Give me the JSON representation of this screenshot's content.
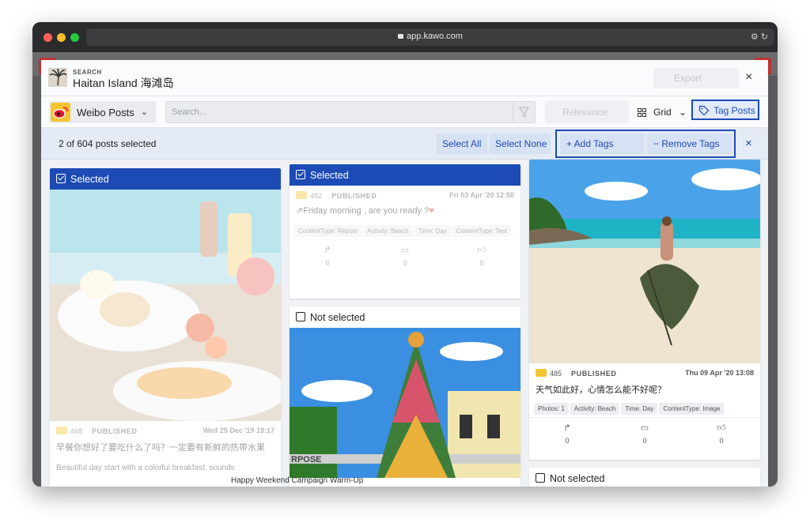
{
  "browser": {
    "url": "app.kawo.com",
    "icons": "⚙︎ ↻"
  },
  "colors": {
    "accent": "#1d4bb5",
    "selected_header": "#1d4bb5",
    "weibo": "#f3c431"
  },
  "header": {
    "kicker": "SEARCH",
    "title": "Haitan Island 海滩岛",
    "export_label": "Export",
    "close_icon": "×"
  },
  "toolbar": {
    "platform": "Weibo Posts",
    "search_placeholder": "Search...",
    "sort_label": "Relevance",
    "view_label": "Grid",
    "tag_posts_label": "Tag Posts"
  },
  "selection_bar": {
    "count_text": "2 of 604 posts selected",
    "select_all": "Select All",
    "select_none": "Select None",
    "add_tags": "+  Add Tags",
    "remove_tags": "−  Remove Tags",
    "close_icon": "×"
  },
  "posts": [
    {
      "header": "Selected",
      "selected": true,
      "count": "468",
      "status": "PUBLISHED",
      "date": "Wed 25 Dec '19 19:17",
      "text": "早餐你想好了要吃什么了吗？一定要有新鲜的热带水果",
      "caption": "Beautiful day start with a colorful breakfast, sounds"
    },
    {
      "header": "Selected",
      "selected": true,
      "count": "482",
      "status": "PUBLISHED",
      "date": "Fri 03 Apr '20 12:50",
      "text": "Friday morning , are you ready ?",
      "tags": [
        "ContentType: Repost",
        "Activity: Beach",
        "Time: Day",
        "ContentType: Test"
      ],
      "stats": [
        "0",
        "0",
        "0"
      ]
    },
    {
      "header": "Not selected",
      "selected": false,
      "bottom_caption": "Happy Weekend Campaign Warm-Up",
      "sign_text": "RPOSE"
    },
    {
      "count": "485",
      "status": "PUBLISHED",
      "date": "Thu 09 Apr '20 13:08",
      "text": "天气如此好，心情怎么能不好呢？",
      "tags": [
        "Photos: 1",
        "Activity: Beach",
        "Time: Day",
        "ContentType: Image"
      ],
      "stats": [
        "0",
        "0",
        "0"
      ],
      "next_header": "Not selected"
    }
  ]
}
